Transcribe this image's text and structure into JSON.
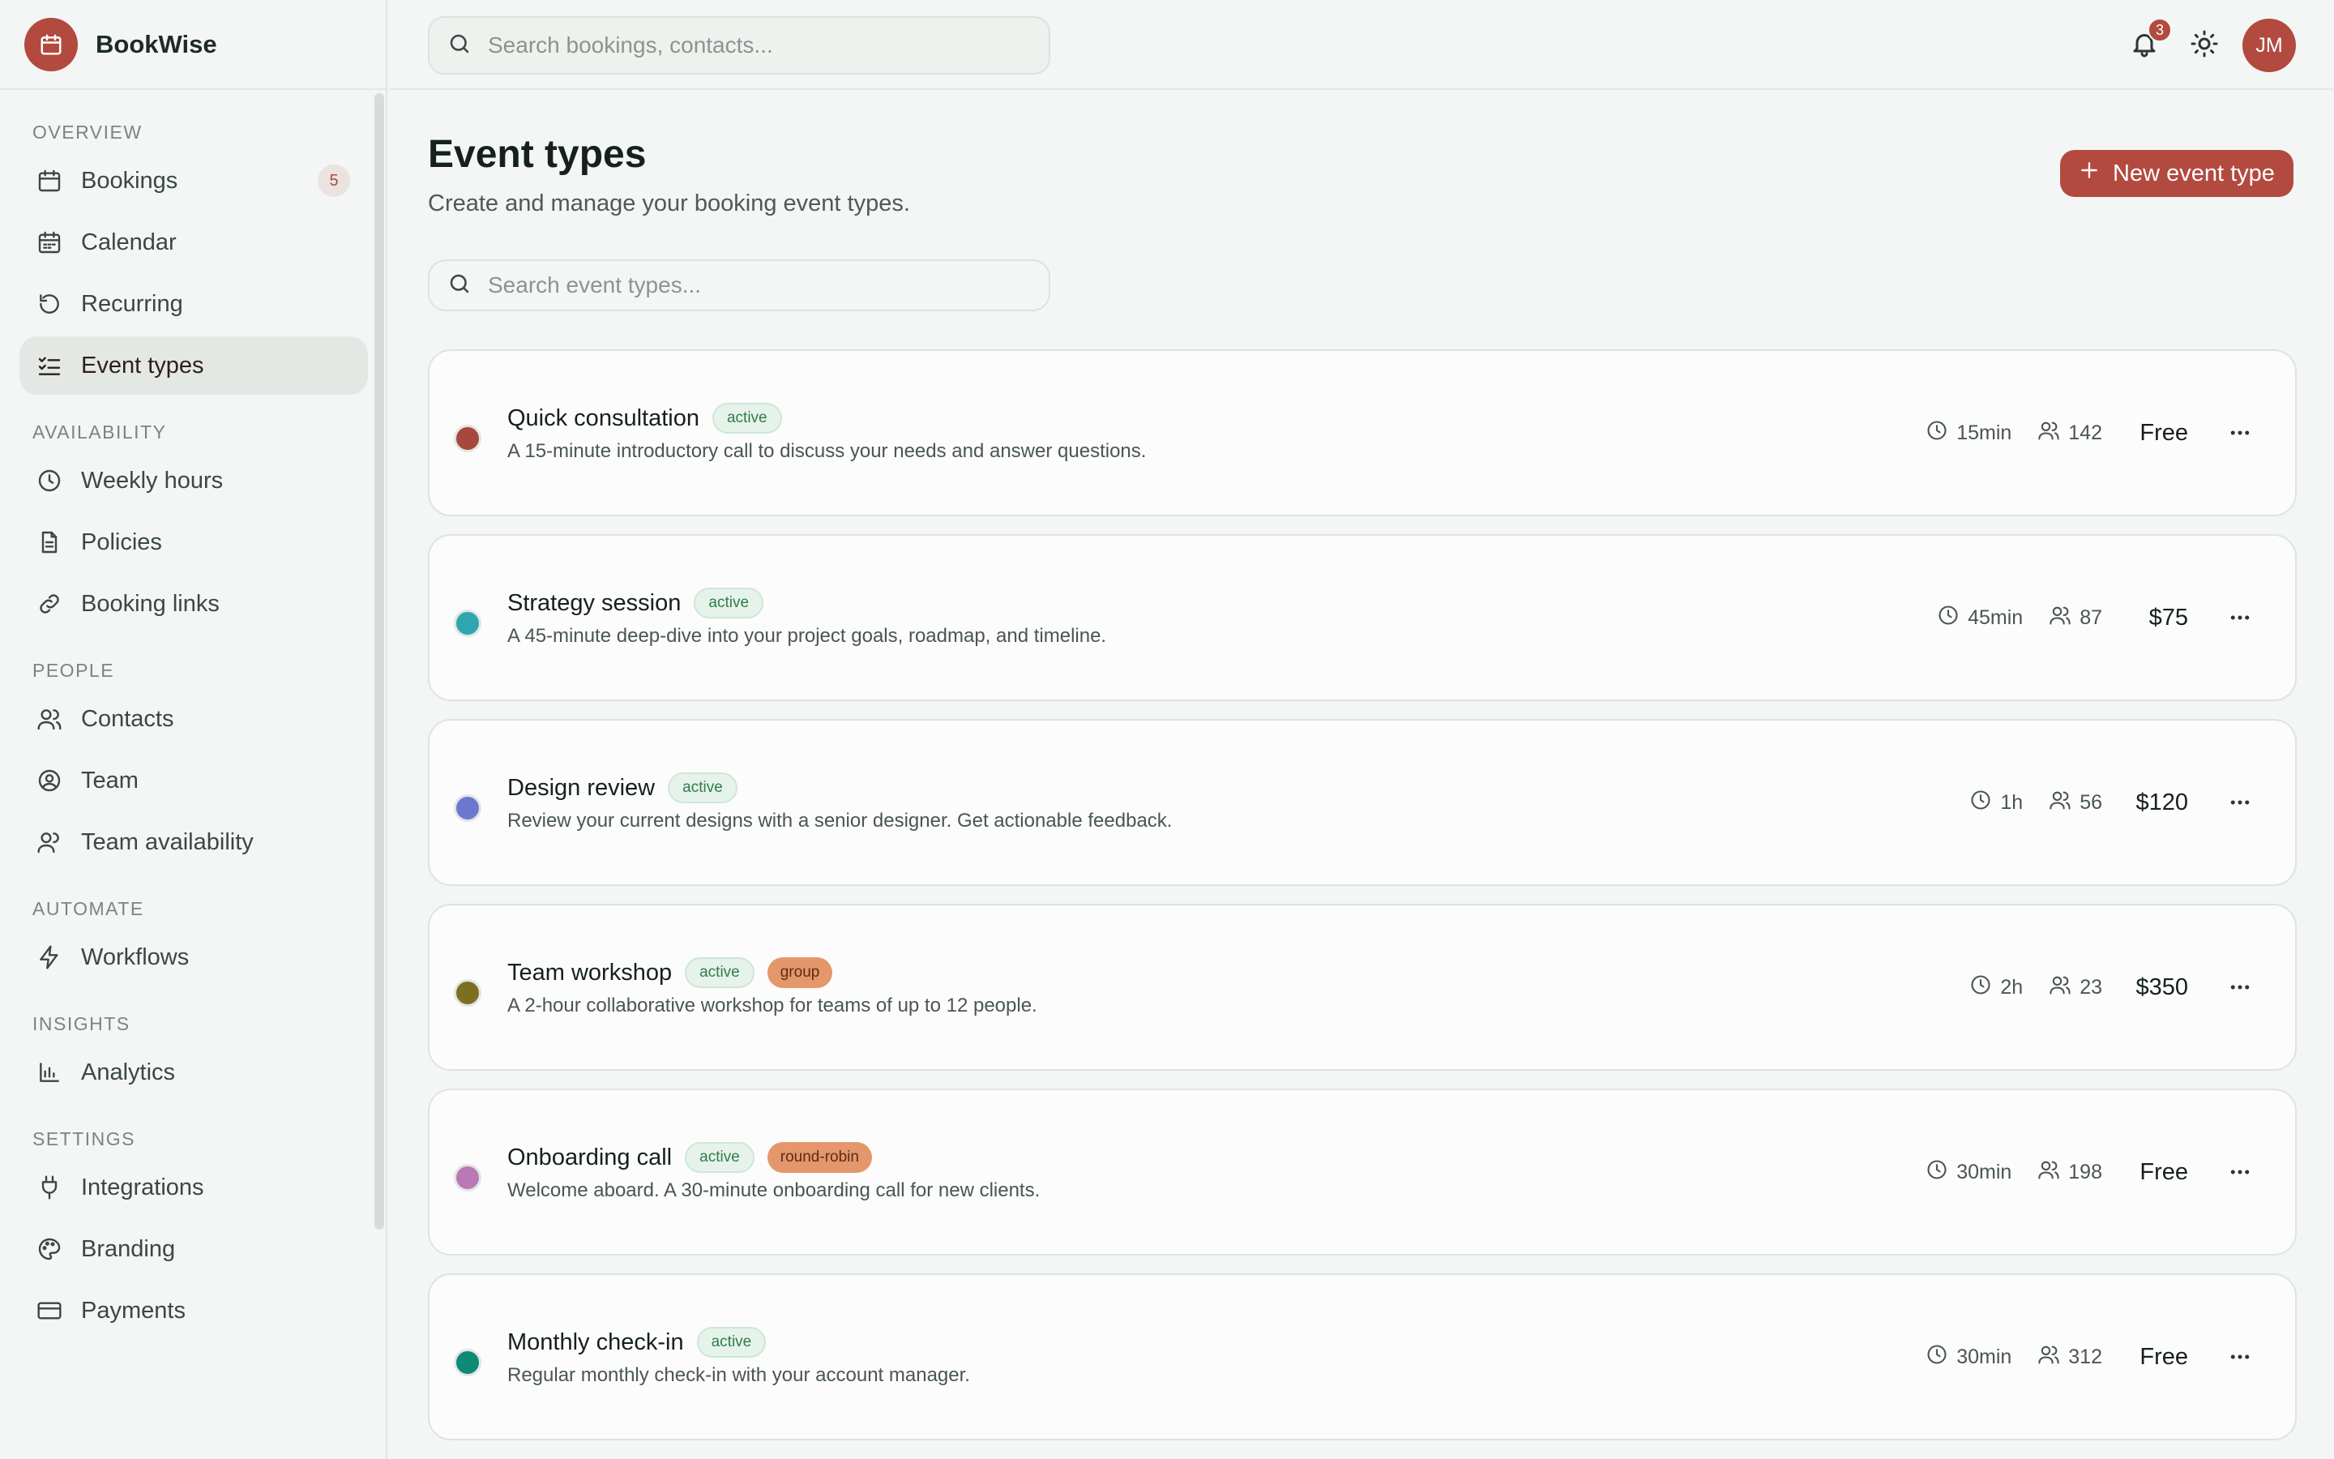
{
  "app": {
    "name": "BookWise"
  },
  "topbar": {
    "search_placeholder": "Search bookings, contacts...",
    "notification_count": "3",
    "avatar_initials": "JM"
  },
  "sidebar": {
    "sections": [
      {
        "label": "OVERVIEW",
        "items": [
          {
            "label": "Bookings",
            "icon": "calendar-icon",
            "badge": "5"
          },
          {
            "label": "Calendar",
            "icon": "calendar-grid-icon"
          },
          {
            "label": "Recurring",
            "icon": "rotate-icon"
          },
          {
            "label": "Event types",
            "icon": "list-check-icon",
            "active": true
          }
        ]
      },
      {
        "label": "AVAILABILITY",
        "items": [
          {
            "label": "Weekly hours",
            "icon": "clock-icon"
          },
          {
            "label": "Policies",
            "icon": "document-icon"
          },
          {
            "label": "Booking links",
            "icon": "link-icon"
          }
        ]
      },
      {
        "label": "PEOPLE",
        "items": [
          {
            "label": "Contacts",
            "icon": "users-icon"
          },
          {
            "label": "Team",
            "icon": "user-circle-icon"
          },
          {
            "label": "Team availability",
            "icon": "user-group-icon"
          }
        ]
      },
      {
        "label": "AUTOMATE",
        "items": [
          {
            "label": "Workflows",
            "icon": "lightning-icon"
          }
        ]
      },
      {
        "label": "INSIGHTS",
        "items": [
          {
            "label": "Analytics",
            "icon": "bar-chart-icon"
          }
        ]
      },
      {
        "label": "SETTINGS",
        "items": [
          {
            "label": "Integrations",
            "icon": "plug-icon"
          },
          {
            "label": "Branding",
            "icon": "palette-icon"
          },
          {
            "label": "Payments",
            "icon": "credit-card-icon"
          }
        ]
      }
    ]
  },
  "main": {
    "title": "Event types",
    "subtitle": "Create and manage your booking event types.",
    "new_button_label": "New event type",
    "search_placeholder": "Search event types...",
    "event_types": [
      {
        "name": "Quick consultation",
        "tags": [
          "active"
        ],
        "description": "A 15-minute introductory call to discuss your needs and answer questions.",
        "duration": "15min",
        "bookings": "142",
        "price": "Free",
        "color": "#a8473d"
      },
      {
        "name": "Strategy session",
        "tags": [
          "active"
        ],
        "description": "A 45-minute deep-dive into your project goals, roadmap, and timeline.",
        "duration": "45min",
        "bookings": "87",
        "price": "$75",
        "color": "#2ea6b0"
      },
      {
        "name": "Design review",
        "tags": [
          "active"
        ],
        "description": "Review your current designs with a senior designer. Get actionable feedback.",
        "duration": "1h",
        "bookings": "56",
        "price": "$120",
        "color": "#6f78cf"
      },
      {
        "name": "Team workshop",
        "tags": [
          "active",
          "group"
        ],
        "description": "A 2-hour collaborative workshop for teams of up to 12 people.",
        "duration": "2h",
        "bookings": "23",
        "price": "$350",
        "color": "#7d6e22"
      },
      {
        "name": "Onboarding call",
        "tags": [
          "active",
          "round-robin"
        ],
        "description": "Welcome aboard. A 30-minute onboarding call for new clients.",
        "duration": "30min",
        "bookings": "198",
        "price": "Free",
        "color": "#b979b5"
      },
      {
        "name": "Monthly check-in",
        "tags": [
          "active"
        ],
        "description": "Regular monthly check-in with your account manager.",
        "duration": "30min",
        "bookings": "312",
        "price": "Free",
        "color": "#0f8a74"
      }
    ]
  },
  "colors": {
    "accent": "#b24a3f",
    "background": "#f3f6f4",
    "card": "#fbfcfb"
  }
}
